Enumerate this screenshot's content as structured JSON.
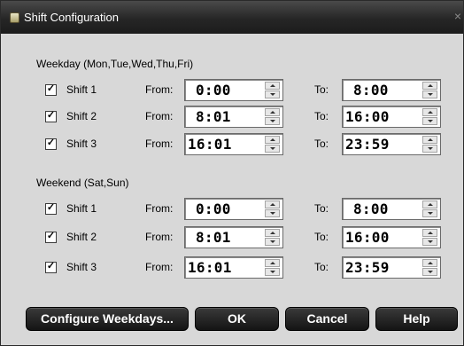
{
  "window": {
    "title": "Shift Configuration",
    "close": "×"
  },
  "labels": {
    "from": "From:",
    "to": "To:"
  },
  "weekday": {
    "label": "Weekday (Mon,Tue,Wed,Thu,Fri)",
    "shifts": [
      {
        "label": "Shift 1",
        "checked": true,
        "check_mark": "✓",
        "from": "0:00",
        "to": "8:00"
      },
      {
        "label": "Shift 2",
        "checked": true,
        "check_mark": "✓",
        "from": "8:01",
        "to": "16:00"
      },
      {
        "label": "Shift 3",
        "checked": true,
        "check_mark": "✓",
        "from": "16:01",
        "to": "23:59"
      }
    ]
  },
  "weekend": {
    "label": "Weekend (Sat,Sun)",
    "shifts": [
      {
        "label": "Shift 1",
        "checked": true,
        "check_mark": "✓",
        "from": "0:00",
        "to": "8:00"
      },
      {
        "label": "Shift 2",
        "checked": true,
        "check_mark": "✓",
        "from": "8:01",
        "to": "16:00"
      },
      {
        "label": "Shift 3",
        "checked": true,
        "check_mark": "✓",
        "from": "16:01",
        "to": "23:59"
      }
    ]
  },
  "buttons": {
    "configure": "Configure Weekdays...",
    "ok": "OK",
    "cancel": "Cancel",
    "help": "Help"
  },
  "colors": {
    "dialog_bg": "#d8d8d8",
    "titlebar": "#262626",
    "button": "#1c1c1c"
  }
}
